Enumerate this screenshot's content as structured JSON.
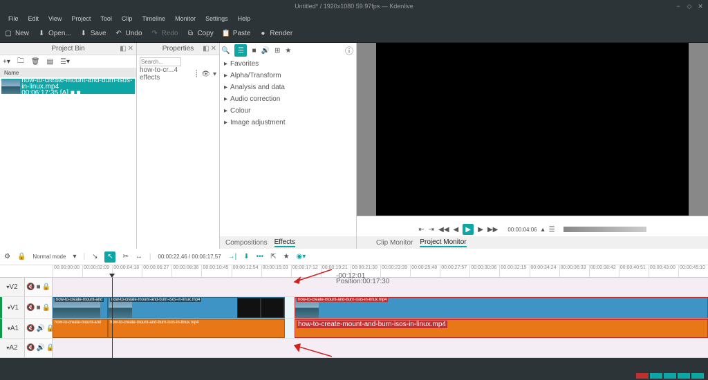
{
  "window": {
    "title": "Untitled* / 1920x1080 59.97fps — Kdenlive"
  },
  "menu": {
    "items": [
      "File",
      "Edit",
      "View",
      "Project",
      "Tool",
      "Clip",
      "Timeline",
      "Monitor",
      "Settings",
      "Help"
    ]
  },
  "toolbar": {
    "new": "New",
    "open": "Open...",
    "save": "Save",
    "undo": "Undo",
    "redo": "Redo",
    "copy": "Copy",
    "paste": "Paste",
    "render": "Render"
  },
  "bin": {
    "title": "Project Bin",
    "name_header": "Name",
    "clip_name": "how-to-create-mount-and-burn-isos-in-linux.mp4",
    "clip_dur": "00:06:17:35 [A] ■ ■"
  },
  "props": {
    "title": "Properties",
    "field": "how-to-cr...4 effects",
    "search": "Search..."
  },
  "effects": {
    "tabs": {
      "comp": "Compositions",
      "eff": "Effects"
    },
    "items": [
      "Favorites",
      "Alpha/Transform",
      "Analysis and data",
      "Audio correction",
      "Colour",
      "Image adjustment"
    ]
  },
  "monitor": {
    "tabs": {
      "clip": "Clip Monitor",
      "proj": "Project Monitor"
    },
    "timecode": "00:00:04:06"
  },
  "tl": {
    "mode": "Normal mode",
    "pos": "00:00:22,46  /  00:06:17,57",
    "ruler": [
      "00:00:00:00",
      "00:00:02:09",
      "00:00:04:18",
      "00:00:06:27",
      "00:00:08:36",
      "00:00:10:45",
      "00:00:12:54",
      "00:00:15:03",
      "00:00:17:12",
      "00:00:19:21",
      "00:00:21:30",
      "00:00:23:39",
      "00:00:25:48",
      "00:00:27:57",
      "00:00:30:06",
      "00:00:32:15",
      "00:00:34:24",
      "00:00:36:33",
      "00:00:38:42",
      "00:00:40:51",
      "00:00:43:00",
      "00:00:45:10"
    ],
    "tracks": {
      "v2": "V2",
      "v1": "V1",
      "a1": "A1",
      "a2": "A2"
    },
    "tooltip_l1": "-00:12:01",
    "tooltip_l2": "Position:00:17:30",
    "clip1": "how-to-create-mount-and",
    "clip2": "how-to-create-mount-and-burn-isos-in-linux.mp4",
    "clip3": "how-to-create-mount-and-burn-isos-in-linux.mp4",
    "a1": "how-to-create-mount-and",
    "a2": "how-to-create-mount-and-burn-isos-in-linux.mp4",
    "a3": "how-to-create-mount-and-burn-isos-in-linux.mp4"
  }
}
